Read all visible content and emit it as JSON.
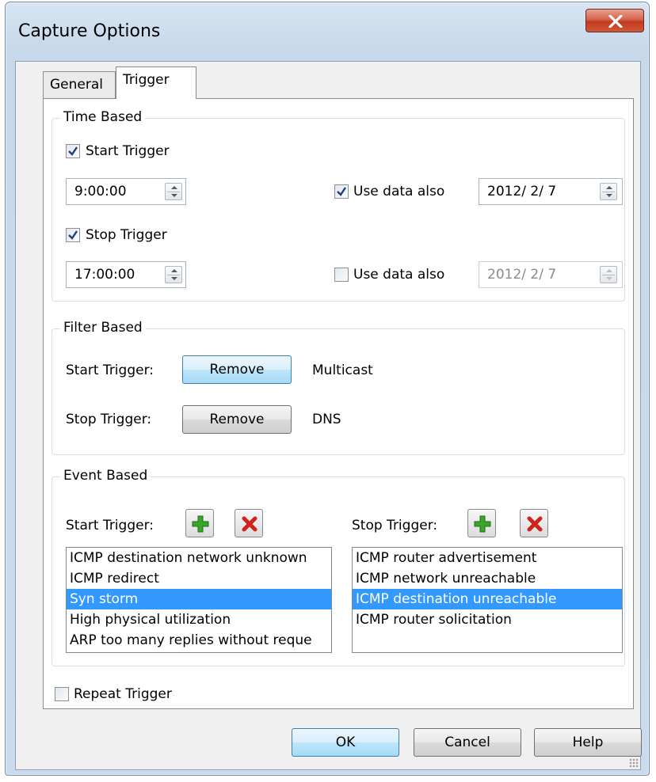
{
  "window": {
    "title": "Capture Options",
    "close_glyph": "x"
  },
  "tabs": [
    {
      "label": "General",
      "active": false
    },
    {
      "label": "Trigger",
      "active": true
    }
  ],
  "time_based": {
    "legend": "Time Based",
    "start": {
      "label": "Start Trigger",
      "checked": true,
      "time": "9:00:00",
      "use_date_label": "Use data also",
      "use_date_checked": true,
      "date": "2012/ 2/ 7",
      "date_enabled": true
    },
    "stop": {
      "label": "Stop Trigger",
      "checked": true,
      "time": "17:00:00",
      "use_date_label": "Use data also",
      "use_date_checked": false,
      "date": "2012/ 2/ 7",
      "date_enabled": false
    }
  },
  "filter_based": {
    "legend": "Filter Based",
    "start": {
      "label": "Start Trigger:",
      "button": "Remove",
      "filter": "Multicast"
    },
    "stop": {
      "label": "Stop Trigger:",
      "button": "Remove",
      "filter": "DNS"
    }
  },
  "event_based": {
    "legend": "Event Based",
    "start": {
      "label": "Start Trigger:",
      "items": [
        "ICMP destination network unknown",
        "ICMP redirect",
        "Syn storm",
        "High physical utilization",
        "ARP too many replies without reque"
      ],
      "selected": 2
    },
    "stop": {
      "label": "Stop Trigger:",
      "items": [
        "ICMP router advertisement",
        "ICMP network unreachable",
        "ICMP destination unreachable",
        "ICMP router solicitation"
      ],
      "selected": 2
    }
  },
  "repeat": {
    "label": "Repeat Trigger",
    "checked": false
  },
  "footer": {
    "ok": "OK",
    "cancel": "Cancel",
    "help": "Help"
  },
  "colors": {
    "selection": "#3399ff",
    "add_icon": "#3aa52a",
    "delete_icon": "#d0231d",
    "close_button": "#c7432a"
  }
}
